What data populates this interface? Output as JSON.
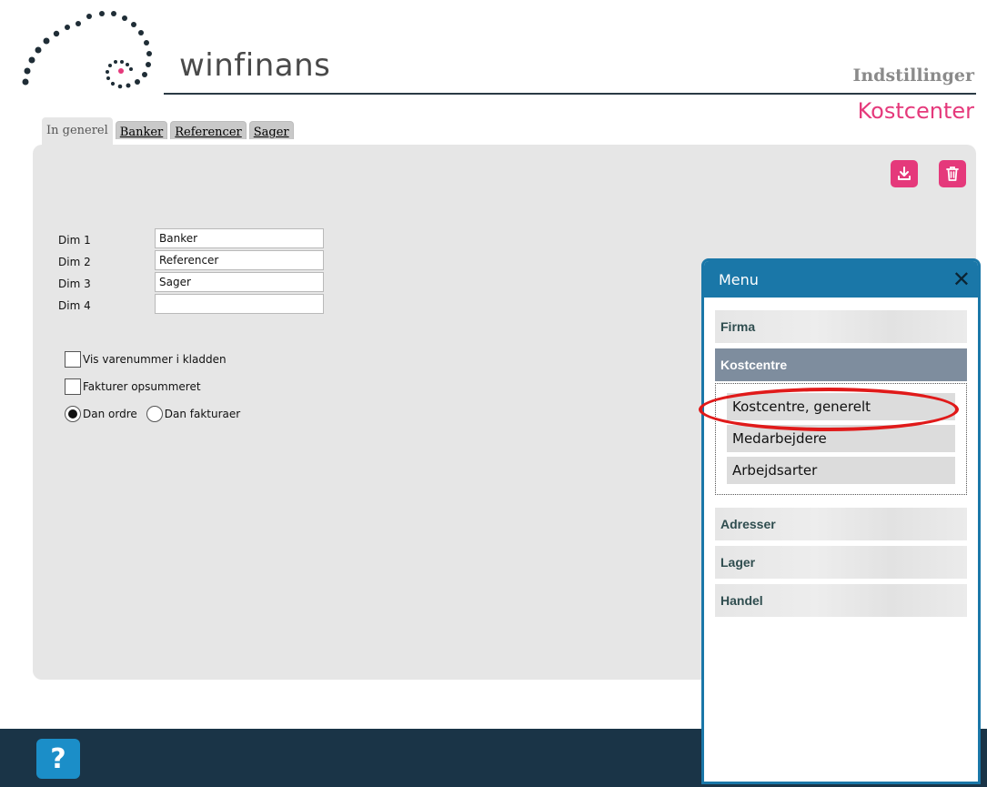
{
  "brand": {
    "name": "winfinans",
    "colors": {
      "accent": "#e5397b",
      "dark": "#1a3447",
      "menu": "#1a77a8"
    }
  },
  "header": {
    "settings_title": "Indstillinger",
    "page_title": "Kostcenter"
  },
  "tabs": [
    {
      "label": "In generel",
      "active": true
    },
    {
      "label": "Banker"
    },
    {
      "label": "Referencer"
    },
    {
      "label": "Sager"
    }
  ],
  "toolbar": {
    "download_icon": "download-icon",
    "delete_icon": "trash-icon"
  },
  "form": {
    "dims": [
      {
        "label": "Dim 1",
        "value": "Banker"
      },
      {
        "label": "Dim 2",
        "value": "Referencer"
      },
      {
        "label": "Dim 3",
        "value": "Sager"
      },
      {
        "label": "Dim 4",
        "value": ""
      }
    ],
    "checkboxes": [
      {
        "label": "Vis varenummer i kladden",
        "checked": false
      },
      {
        "label": "Fakturer opsummeret",
        "checked": false
      }
    ],
    "radios": [
      {
        "label": "Dan ordre",
        "selected": true
      },
      {
        "label": "Dan fakturaer",
        "selected": false
      }
    ]
  },
  "menu": {
    "title": "Menu",
    "sections": [
      {
        "label": "Firma"
      },
      {
        "label": "Kostcentre",
        "active": true,
        "items": [
          "Kostcentre, generelt",
          "Medarbejdere",
          "Arbejdsarter"
        ]
      },
      {
        "label": "Adresser"
      },
      {
        "label": "Lager"
      },
      {
        "label": "Handel"
      }
    ]
  },
  "footer": {
    "help_label": "?"
  }
}
